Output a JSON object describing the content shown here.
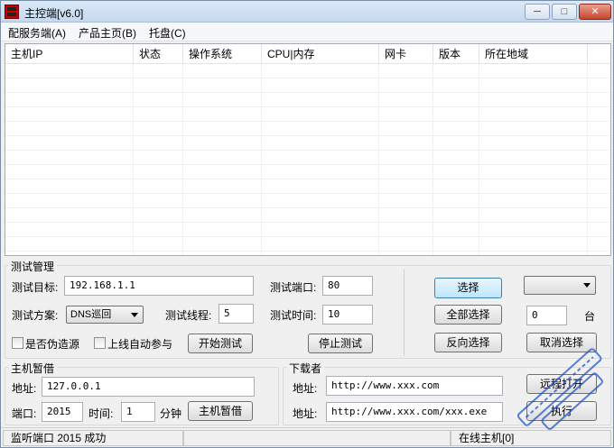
{
  "window": {
    "title": "主控端[v6.0]",
    "controls": {
      "minimize": "─",
      "maximize": "□",
      "close": "✕"
    }
  },
  "menu": [
    "配服务端(A)",
    "产品主页(B)",
    "托盘(C)"
  ],
  "table": {
    "columns": [
      "主机IP",
      "状态",
      "操作系统",
      "CPU|内存",
      "网卡",
      "版本",
      "所在地域"
    ],
    "rows": []
  },
  "test_group": {
    "title": "测试管理",
    "target_label": "测试目标:",
    "target_value": "192.168.1.1",
    "port_label": "测试端口:",
    "port_value": "80",
    "scheme_label": "测试方案:",
    "scheme_value": "DNS巡回",
    "threads_label": "测试线程:",
    "threads_value": "5",
    "time_label": "测试时间:",
    "time_value": "10",
    "spoof_label": "是否伪造源",
    "auto_join_label": "上线自动参与",
    "start_button": "开始测试",
    "stop_button": "停止测试"
  },
  "selection": {
    "select_button": "选择",
    "select_all_button": "全部选择",
    "invert_button": "反向选择",
    "count_value": "0",
    "count_unit": "台",
    "cancel_button": "取消选择",
    "dropdown_value": ""
  },
  "borrow_group": {
    "title": "主机暂借",
    "address_label": "地址:",
    "address_value": "127.0.0.1",
    "port_label": "端口:",
    "port_value": "2015",
    "time_label": "时间:",
    "time_value": "1",
    "time_unit": "分钟",
    "button": "主机暂借"
  },
  "downloader_group": {
    "title": "下载者",
    "address1_label": "地址:",
    "address1_value": "http://www.xxx.com",
    "address2_label": "地址:",
    "address2_value": "http://www.xxx.com/xxx.exe",
    "remote_button": "远程打开",
    "execute_button": "执行"
  },
  "status": {
    "left": "监听端口 2015 成功",
    "right": "在线主机[0]"
  },
  "colors": {
    "window_bg": "#f0f0f0",
    "title_bg": "#c5d8ee",
    "close_button": "#c7432b",
    "watermark": "#2255cc"
  }
}
